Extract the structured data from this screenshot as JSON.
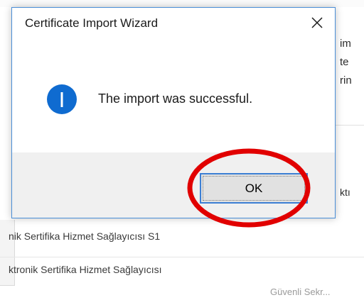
{
  "background": {
    "right_fragments": [
      "im",
      "te",
      "rin"
    ],
    "right_fragment_lower": "ktı",
    "rows": [
      {
        "text": "nik Sertifika Hizmet Sağlayıcısı S1"
      },
      {
        "text": "ktronik Sertifika Hizmet Sağlayıcısı"
      }
    ],
    "bottom_fragment": "Güvenli Sekr..."
  },
  "dialog": {
    "title": "Certificate Import Wizard",
    "message": "The import was successful.",
    "ok_label": "OK",
    "icon": "info-icon",
    "close_icon": "close-icon"
  },
  "colors": {
    "accent_border": "#3c7fd4",
    "info_blue": "#0f6bd0",
    "highlight_red": "#e10000"
  }
}
